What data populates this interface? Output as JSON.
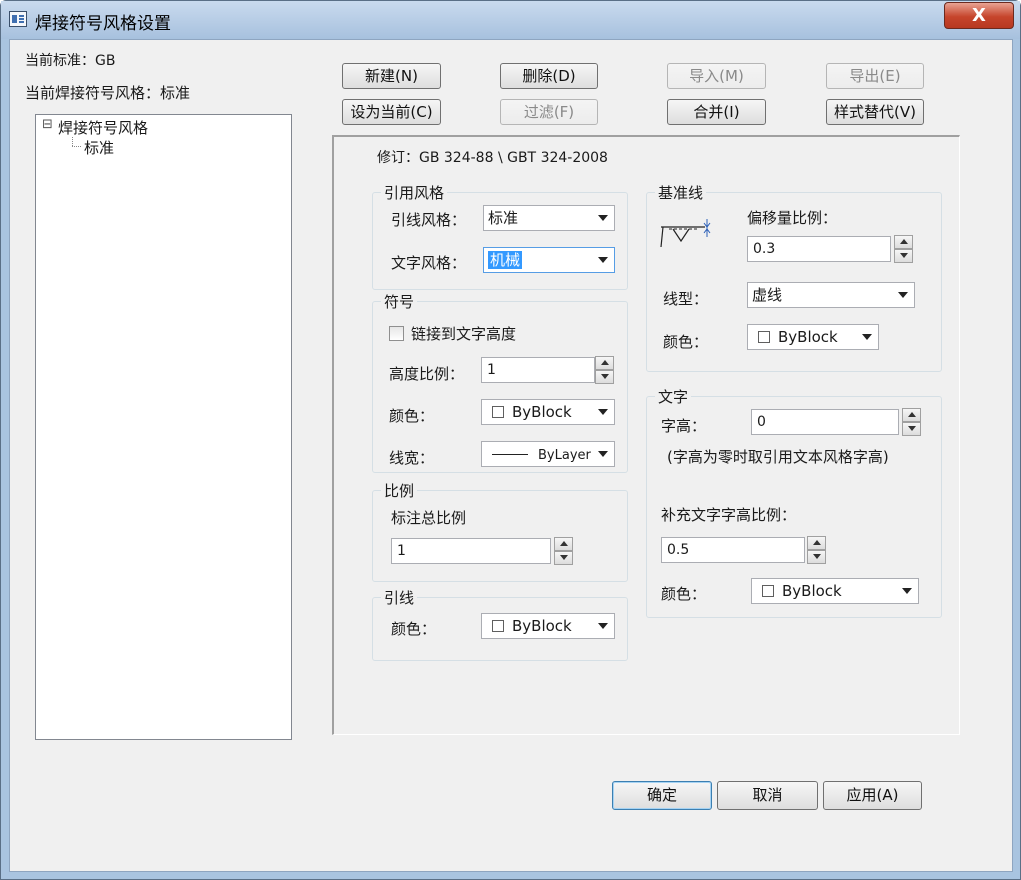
{
  "window": {
    "title": "焊接符号风格设置",
    "close_label": "X"
  },
  "left": {
    "current_standard": "当前标准：GB",
    "current_style": "当前焊接符号风格：标准",
    "tree": {
      "root_toggle": "⊟",
      "root": "焊接符号风格",
      "child": "标准"
    }
  },
  "toolbar": {
    "new_label": "新建(N)",
    "delete_label": "删除(D)",
    "import_label": "导入(M)",
    "export_label": "导出(E)",
    "set_current_label": "设为当前(C)",
    "filter_label": "过滤(F)",
    "merge_label": "合并(I)",
    "style_override_label": "样式替代(V)"
  },
  "panel": {
    "revision": "修订：GB 324-88 \\ GBT 324-2008",
    "ref_style": {
      "title": "引用风格",
      "leader_style_label": "引线风格：",
      "leader_style_value": "标准",
      "text_style_label": "文字风格：",
      "text_style_value": "机械"
    },
    "symbol": {
      "title": "符号",
      "link_label": "链接到文字高度",
      "height_ratio_label": "高度比例：",
      "height_ratio_value": "1",
      "color_label": "颜色：",
      "color_value": "ByBlock",
      "lineweight_label": "线宽：",
      "lineweight_value": "ByLayer"
    },
    "scale": {
      "title": "比例",
      "overall_label": "标注总比例",
      "overall_value": "1"
    },
    "leader": {
      "title": "引线",
      "color_label": "颜色：",
      "color_value": "ByBlock"
    },
    "baseline": {
      "title": "基准线",
      "offset_label": "偏移量比例：",
      "offset_value": "0.3",
      "linetype_label": "线型：",
      "linetype_value": "虚线",
      "color_label": "颜色：",
      "color_value": "ByBlock"
    },
    "text": {
      "title": "文字",
      "height_label": "字高：",
      "height_value": "0",
      "note": "(字高为零时取引用文本风格字高)",
      "supp_ratio_label": "补充文字字高比例：",
      "supp_ratio_value": "0.5",
      "color_label": "颜色：",
      "color_value": "ByBlock"
    }
  },
  "footer": {
    "ok_label": "确定",
    "cancel_label": "取消",
    "apply_label": "应用(A)"
  }
}
